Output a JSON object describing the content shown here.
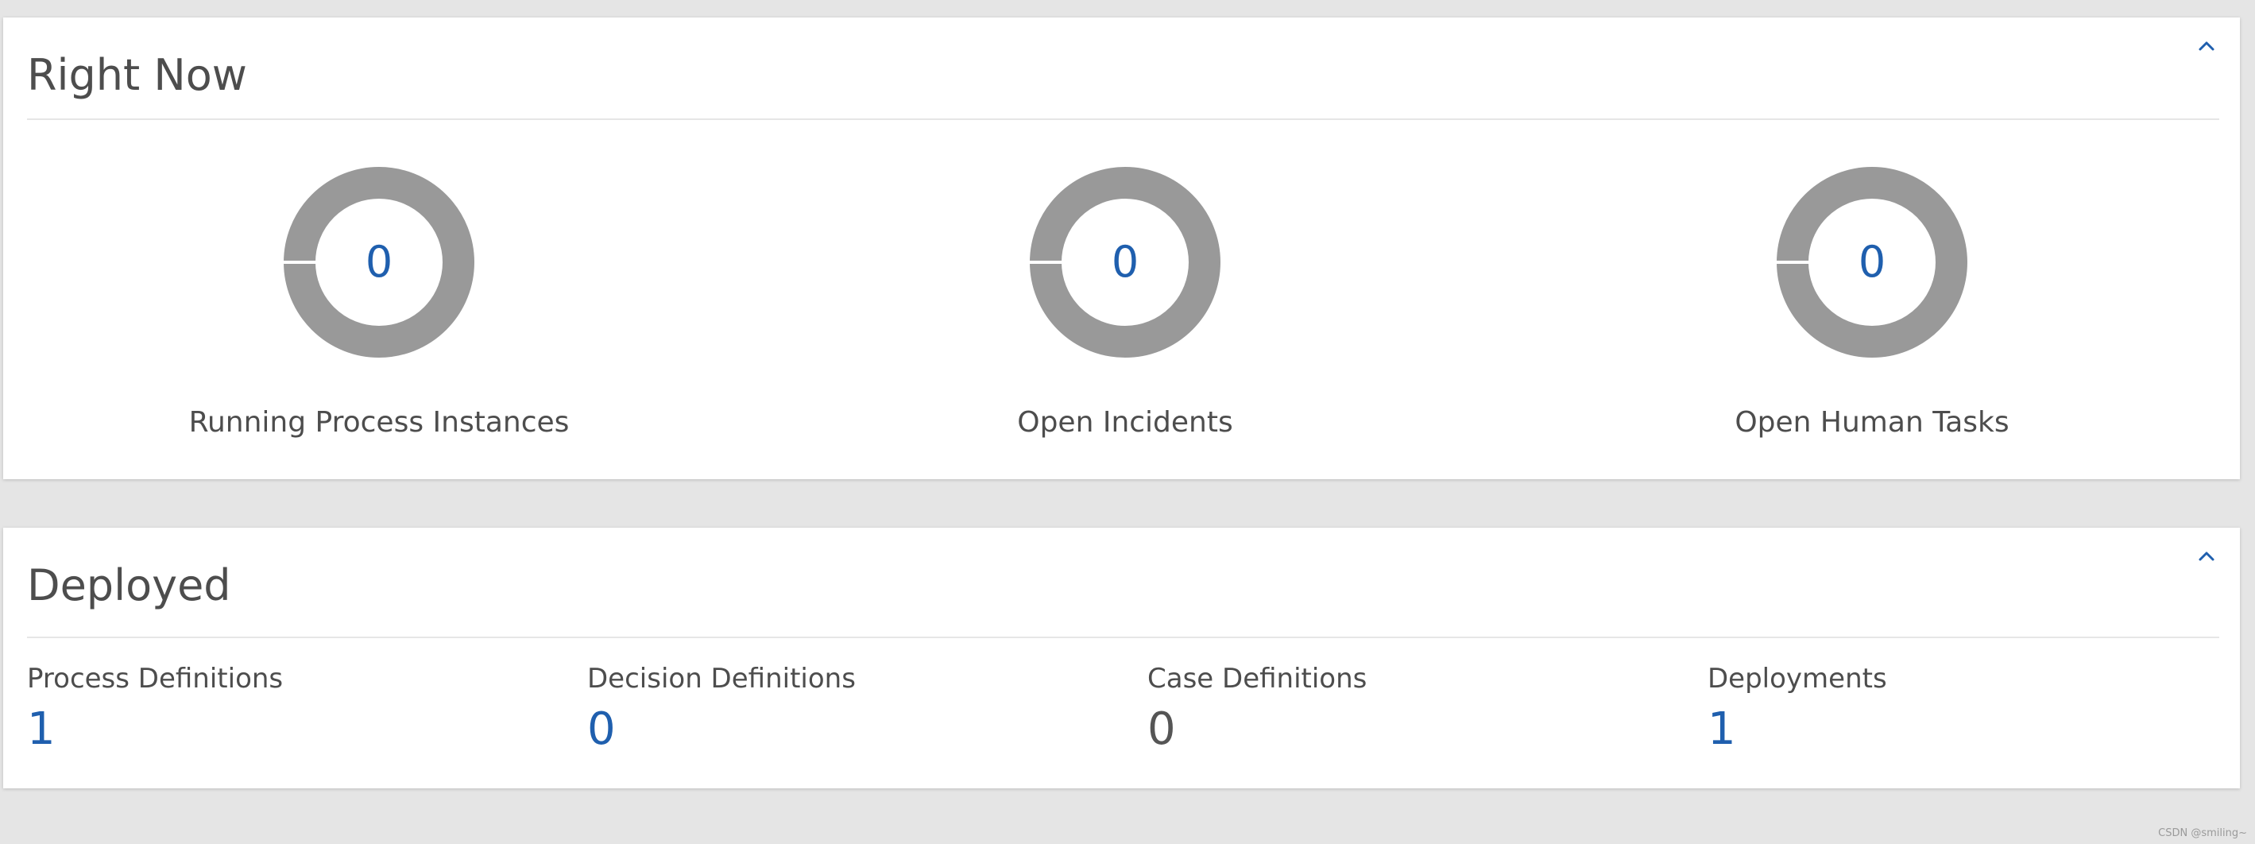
{
  "right_now": {
    "title": "Right Now",
    "stats": [
      {
        "label": "Running Process Instances",
        "value": "0"
      },
      {
        "label": "Open Incidents",
        "value": "0"
      },
      {
        "label": "Open Human Tasks",
        "value": "0"
      }
    ]
  },
  "deployed": {
    "title": "Deployed",
    "stats": [
      {
        "label": "Process Definitions",
        "value": "1"
      },
      {
        "label": "Decision Definitions",
        "value": "0"
      },
      {
        "label": "Case Definitions",
        "value": "0"
      },
      {
        "label": "Deployments",
        "value": "1"
      }
    ]
  },
  "watermark": "CSDN @smiling~",
  "colors": {
    "page_background": "#e5e5e5",
    "panel_background": "#ffffff",
    "accent_blue": "#1f5fae",
    "donut_gray": "#999999",
    "text_dark": "#4d4d4d"
  },
  "icons": {
    "collapse": "chevron-up-icon"
  }
}
